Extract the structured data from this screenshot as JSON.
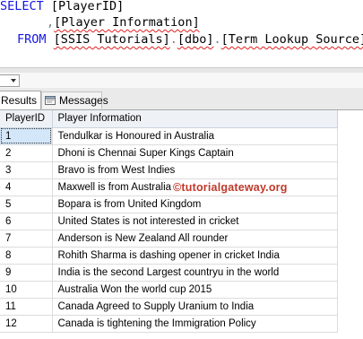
{
  "editor": {
    "line1": {
      "keyword": "SELECT",
      "column": "[PlayerID]"
    },
    "line2": {
      "comma": ",",
      "column": "[Player Information]"
    },
    "line3": {
      "keyword": "FROM",
      "db": "[SSIS Tutorials]",
      "dot1": ".",
      "schema": "[dbo]",
      "dot2": ".",
      "table": "[Term Lookup Source]"
    }
  },
  "tabs": {
    "results": "Results",
    "messages": "Messages"
  },
  "grid": {
    "columns": [
      "PlayerID",
      "Player Information"
    ],
    "rows": [
      [
        "1",
        "Tendulkar is Honoured in Australia"
      ],
      [
        "2",
        "Dhoni is Chennai Super Kings Captain"
      ],
      [
        "3",
        "Bravo is from West Indies"
      ],
      [
        "4",
        "Maxwell is from Australia"
      ],
      [
        "5",
        "Bopara is from United Kingdom"
      ],
      [
        "6",
        "United States is not interested in cricket"
      ],
      [
        "7",
        "Anderson is New Zealand All rounder"
      ],
      [
        "8",
        "Rohith Sharma is dashing opener in cricket India"
      ],
      [
        "9",
        "India is the second Largest countryu in the world"
      ],
      [
        "10",
        "Australia Won the world cup 2015"
      ],
      [
        "11",
        "Canada Agreed to Supply Uranium to India"
      ],
      [
        "12",
        "Canada is tightening the Immigration Policy"
      ]
    ]
  },
  "watermark": "©tutorialgateway.org",
  "colors": {
    "keyword": "#1515e8",
    "squiggle": "#e02020",
    "selected_cell": "#d4e6f9",
    "watermark": "#c0392b"
  }
}
